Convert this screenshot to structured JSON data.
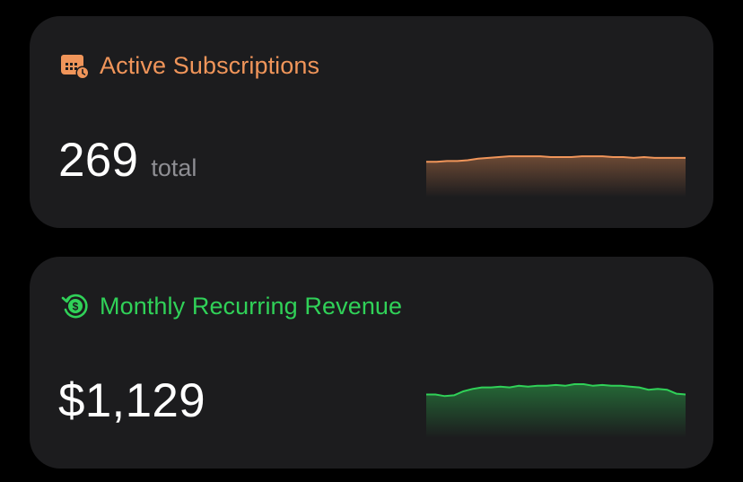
{
  "colors": {
    "subscriptions_accent": "#f0955a",
    "revenue_accent": "#30d158",
    "card_background": "#1c1c1e",
    "secondary_text": "#8e8e93"
  },
  "subscriptions": {
    "icon": "calendar-clock-icon",
    "title": "Active Subscriptions",
    "value": "269",
    "unit": "total",
    "trend": [
      45,
      45,
      46,
      46,
      47,
      49,
      50,
      51,
      52,
      52,
      52,
      52,
      51,
      51,
      51,
      52,
      52,
      52,
      51,
      51,
      50,
      51,
      50,
      50,
      50,
      50
    ]
  },
  "revenue": {
    "icon": "dollar-refresh-icon",
    "title": "Monthly Recurring Revenue",
    "value": "$1,129",
    "trend": [
      55,
      55,
      53,
      54,
      59,
      62,
      64,
      64,
      65,
      64,
      66,
      65,
      66,
      66,
      67,
      66,
      68,
      68,
      66,
      67,
      66,
      66,
      65,
      64,
      61,
      62,
      61,
      56,
      55
    ]
  }
}
